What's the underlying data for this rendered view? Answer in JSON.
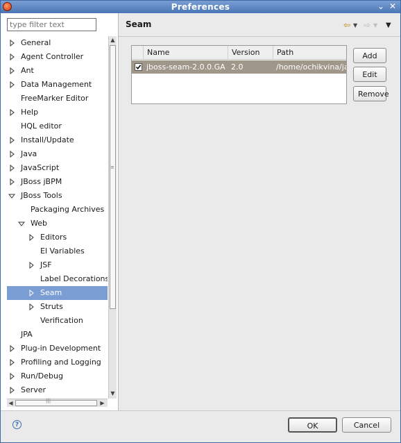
{
  "window": {
    "title": "Preferences"
  },
  "filter": {
    "placeholder": "type filter text"
  },
  "tree": [
    {
      "label": "General",
      "depth": 0,
      "expander": "collapsed"
    },
    {
      "label": "Agent Controller",
      "depth": 0,
      "expander": "collapsed"
    },
    {
      "label": "Ant",
      "depth": 0,
      "expander": "collapsed"
    },
    {
      "label": "Data Management",
      "depth": 0,
      "expander": "collapsed"
    },
    {
      "label": "FreeMarker Editor",
      "depth": 0,
      "expander": "none"
    },
    {
      "label": "Help",
      "depth": 0,
      "expander": "collapsed"
    },
    {
      "label": "HQL editor",
      "depth": 0,
      "expander": "none"
    },
    {
      "label": "Install/Update",
      "depth": 0,
      "expander": "collapsed"
    },
    {
      "label": "Java",
      "depth": 0,
      "expander": "collapsed"
    },
    {
      "label": "JavaScript",
      "depth": 0,
      "expander": "collapsed"
    },
    {
      "label": "JBoss jBPM",
      "depth": 0,
      "expander": "collapsed"
    },
    {
      "label": "JBoss Tools",
      "depth": 0,
      "expander": "expanded"
    },
    {
      "label": "Packaging Archives",
      "depth": 1,
      "expander": "none"
    },
    {
      "label": "Web",
      "depth": 1,
      "expander": "expanded"
    },
    {
      "label": "Editors",
      "depth": 2,
      "expander": "collapsed"
    },
    {
      "label": "El Variables",
      "depth": 2,
      "expander": "none"
    },
    {
      "label": "JSF",
      "depth": 2,
      "expander": "collapsed"
    },
    {
      "label": "Label Decorations",
      "depth": 2,
      "expander": "none"
    },
    {
      "label": "Seam",
      "depth": 2,
      "expander": "collapsed",
      "selected": true
    },
    {
      "label": "Struts",
      "depth": 2,
      "expander": "collapsed"
    },
    {
      "label": "Verification",
      "depth": 2,
      "expander": "none"
    },
    {
      "label": "JPA",
      "depth": 0,
      "expander": "none"
    },
    {
      "label": "Plug-in Development",
      "depth": 0,
      "expander": "collapsed"
    },
    {
      "label": "Profiling and Logging",
      "depth": 0,
      "expander": "collapsed"
    },
    {
      "label": "Run/Debug",
      "depth": 0,
      "expander": "collapsed"
    },
    {
      "label": "Server",
      "depth": 0,
      "expander": "collapsed"
    }
  ],
  "page": {
    "title": "Seam"
  },
  "runtimes_table": {
    "columns": [
      "Name",
      "Version",
      "Path"
    ],
    "rows": [
      {
        "checked": true,
        "name": "jboss-seam-2.0.0.GA",
        "version": "2.0",
        "path": "/home/ochikvina/jav"
      }
    ]
  },
  "buttons": {
    "add": "Add",
    "edit": "Edit",
    "remove": "Remove",
    "ok": "OK",
    "cancel": "Cancel"
  },
  "icons": {
    "app": "eclipse-icon",
    "minimize": "minimize-icon",
    "close": "close-icon",
    "back": "back-arrow-icon",
    "forward": "forward-arrow-icon",
    "view_menu": "view-menu-icon",
    "help": "help-icon"
  },
  "colors": {
    "titlebar": "#4a75b5",
    "selection": "#7a9ed3",
    "table_selection": "#9e978a"
  }
}
